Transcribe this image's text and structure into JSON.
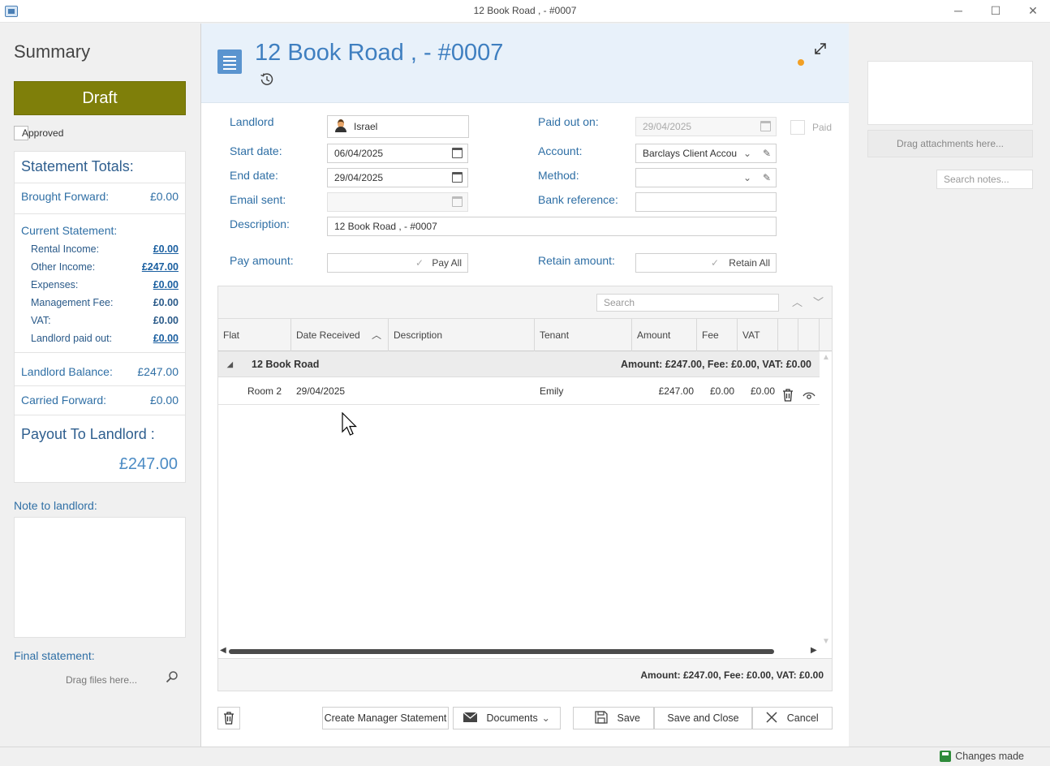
{
  "window": {
    "title": "12 Book Road ,  - #0007",
    "min": "─",
    "max": "☐",
    "close": "✕"
  },
  "left": {
    "title": "Summary",
    "status_button": "Draft",
    "approved_label": "Approved",
    "totals": {
      "heading": "Statement Totals:",
      "brought_forward": {
        "label": "Brought Forward:",
        "value": "£0.00"
      },
      "current_statement": "Current Statement:",
      "rental_income": {
        "label": "Rental Income:",
        "value": "£0.00"
      },
      "other_income": {
        "label": "Other Income:",
        "value": "£247.00"
      },
      "expenses": {
        "label": "Expenses:",
        "value": "£0.00"
      },
      "management_fee": {
        "label": "Management Fee:",
        "value": "£0.00"
      },
      "vat": {
        "label": "VAT:",
        "value": "£0.00"
      },
      "landlord_paid_out": {
        "label": "Landlord paid out:",
        "value": "£0.00"
      },
      "landlord_balance": {
        "label": "Landlord Balance:",
        "value": "£247.00"
      },
      "carried_forward": {
        "label": "Carried Forward:",
        "value": "£0.00"
      },
      "payout_label": "Payout To Landlord :",
      "payout_value": "£247.00"
    },
    "note_label": "Note to landlord:",
    "final_statement_label": "Final statement:",
    "drag_files": "Drag files here..."
  },
  "header": {
    "title": "12 Book Road ,  - #0007"
  },
  "form": {
    "landlord": {
      "label": "Landlord",
      "value": "Israel"
    },
    "start_date": {
      "label": "Start date:",
      "value": "06/04/2025"
    },
    "end_date": {
      "label": "End date:",
      "value": "29/04/2025"
    },
    "email_sent": {
      "label": "Email sent:",
      "value": ""
    },
    "description": {
      "label": "Description:",
      "value": "12 Book Road ,  - #0007"
    },
    "pay_amount": {
      "label": "Pay amount:",
      "button": "Pay All"
    },
    "paid_out_on": {
      "label": "Paid out on:",
      "value": "29/04/2025"
    },
    "paid_label": "Paid",
    "account": {
      "label": "Account:",
      "value": "Barclays Client Accou"
    },
    "method": {
      "label": "Method:",
      "value": ""
    },
    "bank_reference": {
      "label": "Bank reference:",
      "value": ""
    },
    "retain_amount": {
      "label": "Retain amount:",
      "button": "Retain All"
    }
  },
  "grid": {
    "search_placeholder": "Search",
    "columns": [
      "Flat",
      "Date Received",
      "Description",
      "Tenant",
      "Amount",
      "Fee",
      "VAT"
    ],
    "group": {
      "name": "12 Book Road",
      "summary": "Amount: £247.00,    Fee: £0.00,    VAT: £0.00"
    },
    "rows": [
      {
        "flat": "Room 2",
        "date": "29/04/2025",
        "description": "",
        "tenant": "Emily",
        "amount": "£247.00",
        "fee": "£0.00",
        "vat": "£0.00"
      }
    ],
    "footer": "Amount: £247.00, Fee: £0.00, VAT: £0.00"
  },
  "buttons": {
    "create_manager_statement": "Create Manager Statement",
    "documents": "Documents",
    "save": "Save",
    "save_and_close": "Save and Close",
    "cancel": "Cancel"
  },
  "right": {
    "drag_attachments": "Drag attachments here...",
    "search_notes_placeholder": "Search notes..."
  },
  "status": {
    "changes": "Changes made"
  },
  "colors": {
    "draft": "#7f7f0a",
    "accent": "#3f7fc0",
    "unsaved_dot": "#f2a024"
  }
}
